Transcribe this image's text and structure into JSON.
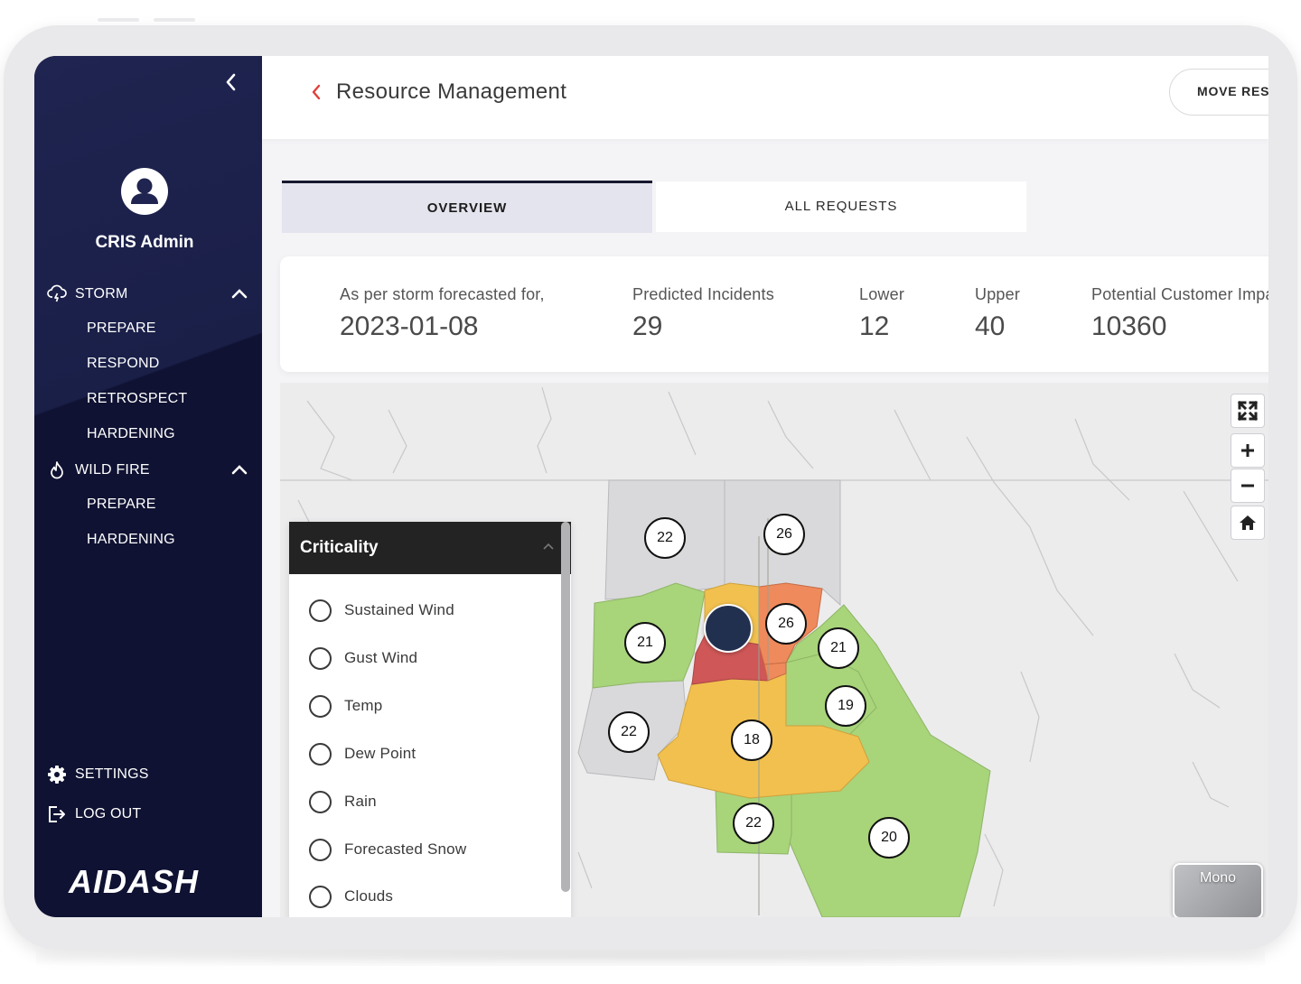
{
  "sidebar": {
    "admin_name": "CRIS Admin",
    "sections": [
      {
        "label": "STORM",
        "icon": "storm-cloud-icon",
        "expanded": true,
        "items": [
          "PREPARE",
          "RESPOND",
          "RETROSPECT",
          "HARDENING"
        ]
      },
      {
        "label": "WILD FIRE",
        "icon": "flame-icon",
        "expanded": true,
        "items": [
          "PREPARE",
          "HARDENING"
        ]
      }
    ],
    "settings_label": "SETTINGS",
    "logout_label": "LOG OUT",
    "brand": "AIDASH"
  },
  "header": {
    "title": "Resource Management",
    "move_button": "MOVE RESOURCES"
  },
  "tabs": [
    {
      "label": "OVERVIEW",
      "active": true
    },
    {
      "label": "ALL REQUESTS",
      "active": false
    }
  ],
  "stats": {
    "forecast_label": "As per storm forecasted for,",
    "forecast_date": "2023-01-08",
    "predicted_label": "Predicted Incidents",
    "predicted_value": "29",
    "lower_label": "Lower",
    "lower_value": "12",
    "upper_label": "Upper",
    "upper_value": "40",
    "customer_label": "Potential Customer Impact",
    "customer_value": "10360"
  },
  "criticality": {
    "title": "Criticality",
    "options": [
      "Sustained Wind",
      "Gust Wind",
      "Temp",
      "Dew Point",
      "Rain",
      "Forecasted Snow",
      "Clouds"
    ]
  },
  "map": {
    "markers": [
      "22",
      "26",
      "21",
      "26",
      "21",
      "19",
      "22",
      "18",
      "22",
      "20"
    ],
    "basemap_label": "Mono",
    "colors": {
      "green": "#a8d47a",
      "yellow": "#f1c04f",
      "orange": "#ef8a5c",
      "red": "#cf5757",
      "gray": "#d6d6d8",
      "pin": "#22304f"
    }
  },
  "colors": {
    "sidebar": "#0f1232",
    "accent": "#e0403a",
    "tab_active": "#e4e4ee"
  }
}
